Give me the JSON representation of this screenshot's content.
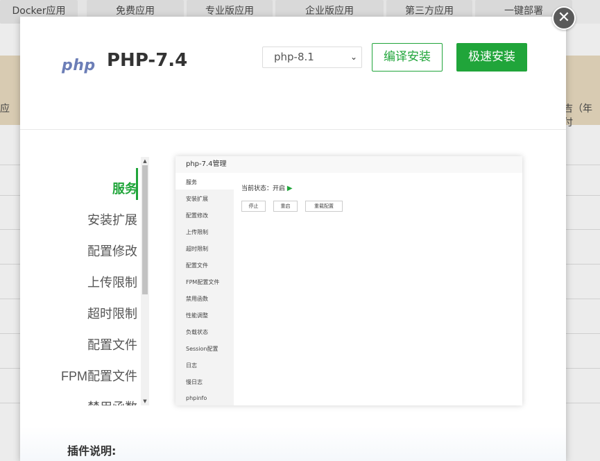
{
  "background": {
    "tabs": [
      "Docker应用",
      "免费应用",
      "专业版应用",
      "企业版应用",
      "第三方应用",
      "一键部署"
    ],
    "left_fragment": "应",
    "right_fragment": "吉（年付"
  },
  "modal": {
    "title": "PHP-7.4",
    "logo_text": "php",
    "close_glyph": "✕",
    "version_select": {
      "value": "php-8.1",
      "chevron": "⌄"
    },
    "compile_button": "编译安装",
    "fast_button": "极速安装",
    "nav_items": [
      "服务",
      "安装扩展",
      "配置修改",
      "上传限制",
      "超时限制",
      "配置文件",
      "FPM配置文件",
      "禁用函数"
    ],
    "nav_active_index": 0,
    "plugin_desc_label": "插件说明:",
    "accent_color": "#20a53a"
  },
  "preview": {
    "title": "php-7.4管理",
    "menu_items": [
      "服务",
      "安装扩展",
      "配置修改",
      "上传限制",
      "超时限制",
      "配置文件",
      "FPM配置文件",
      "禁用函数",
      "性能调整",
      "负载状态",
      "Session配置",
      "日志",
      "慢日志",
      "phpinfo"
    ],
    "status_text": "当前状态：开启",
    "status_icon": "▶",
    "buttons": [
      "停止",
      "重启",
      "重载配置"
    ]
  }
}
